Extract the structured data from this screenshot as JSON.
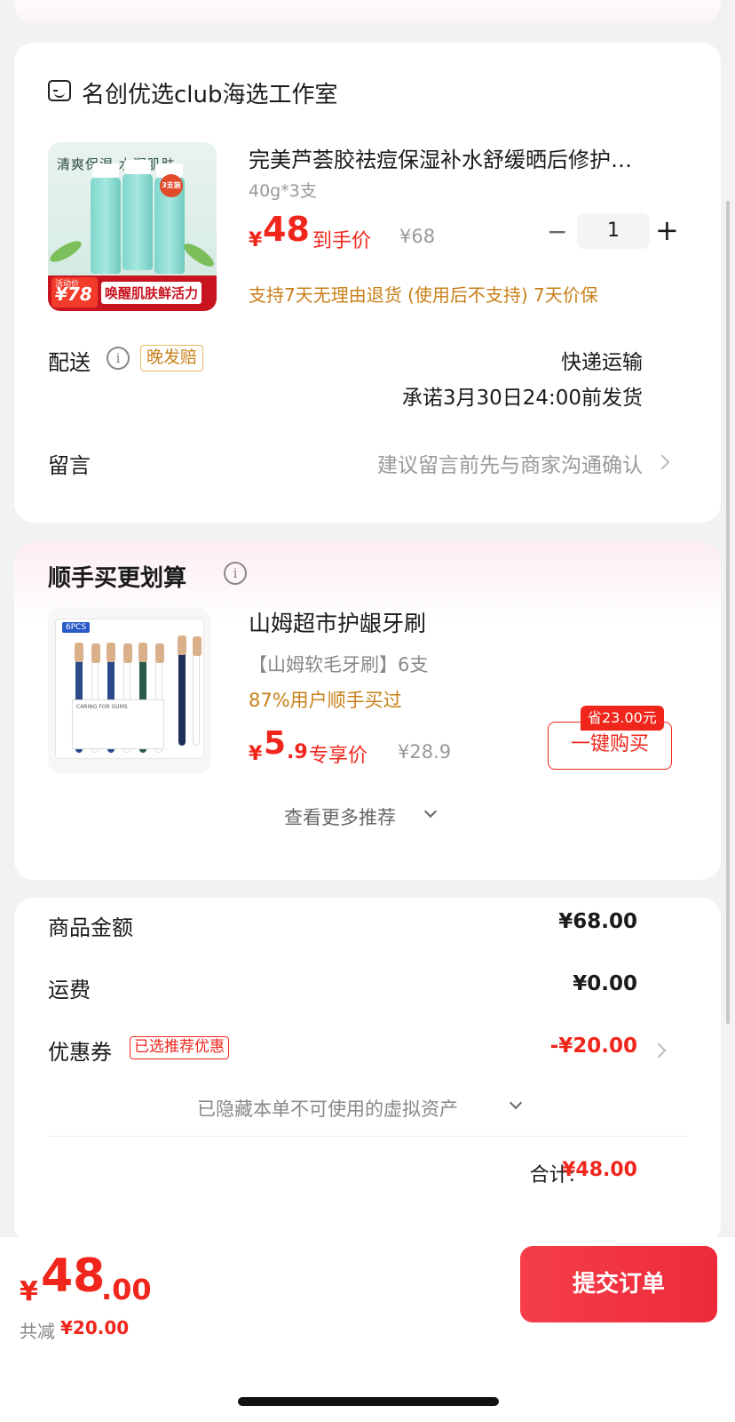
{
  "store": {
    "name": "名创优选club海选工作室",
    "icon": "store-icon"
  },
  "product": {
    "title": "完美芦荟胶祛痘保湿补水舒缓晒后修护…",
    "spec": "40g*3支",
    "currency": "¥",
    "price": "48",
    "price_label": "到手价",
    "original_price": "¥68",
    "quantity": "1",
    "minus": "−",
    "plus": "+",
    "guarantee": "支持7天无理由退货 (使用后不支持)  7天价保",
    "image": {
      "banner": "清爽保湿 水润肌肤",
      "badge": "3支装",
      "promo_small": "活动价",
      "promo_price": "¥78",
      "slogan": "唤醒肌肤鲜活力"
    }
  },
  "shipping": {
    "label": "配送",
    "info_icon": "i",
    "late_badge": "晚发赔",
    "method": "快递运输",
    "promise": "承诺3月30日24:00前发货"
  },
  "message": {
    "label": "留言",
    "placeholder": "建议留言前先与商家沟通确认"
  },
  "addon": {
    "title": "顺手买更划算",
    "item": {
      "title": "山姆超市护龈牙刷",
      "subtitle": "【山姆软毛牙刷】6支",
      "popularity": "87%用户顺手买过",
      "currency": "¥",
      "price": "5",
      "price_decimal": ".9",
      "price_label": "专享价",
      "original_price": "¥28.9",
      "save_badge": "省23.00元",
      "buy_button": "一键购买",
      "image": {
        "pcs": "6PCS",
        "card_text": "CARING FOR GUMS"
      }
    },
    "more": "查看更多推荐"
  },
  "summary": {
    "goods_label": "商品金额",
    "goods_value": "¥68.00",
    "freight_label": "运费",
    "freight_value": "¥0.00",
    "coupon_label": "优惠券",
    "coupon_badge": "已选推荐优惠",
    "coupon_value": "-¥20.00",
    "hidden_assets": "已隐藏本单不可使用的虚拟资产",
    "total_label": "合计:",
    "total_value": "¥48.00"
  },
  "footer": {
    "currency": "¥",
    "price_int": "48",
    "price_dec": ".00",
    "save_label": "共减",
    "save_value": "¥20.00",
    "submit": "提交订单"
  },
  "colors": {
    "accent": "#f0261c",
    "gold": "#c8801a",
    "background": "#f2f2f2"
  }
}
